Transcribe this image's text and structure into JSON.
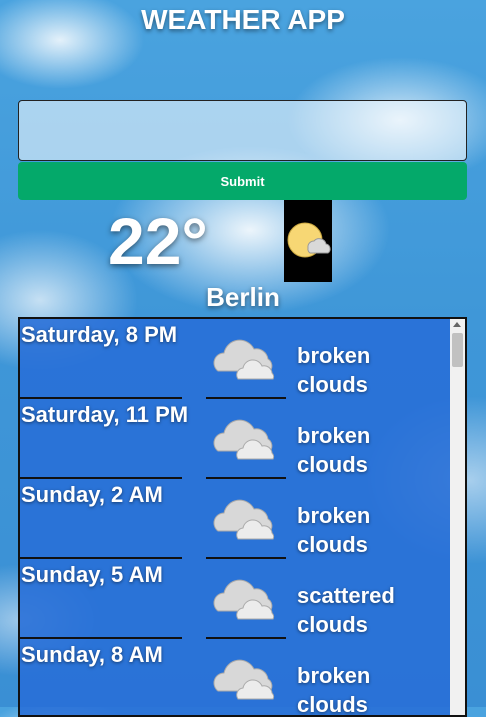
{
  "app": {
    "title": "WEATHER APP"
  },
  "search": {
    "value": "",
    "placeholder": "",
    "submit_label": "Submit"
  },
  "current": {
    "temperature": "22°",
    "city": "Berlin",
    "icon": "moon-cloud-icon"
  },
  "forecast": [
    {
      "time": "Saturday, 8 PM",
      "description": "broken clouds",
      "icon": "cloud-icon"
    },
    {
      "time": "Saturday, 11 PM",
      "description": "broken clouds",
      "icon": "cloud-icon"
    },
    {
      "time": "Sunday, 2 AM",
      "description": "broken clouds",
      "icon": "cloud-icon"
    },
    {
      "time": "Sunday, 5 AM",
      "description": "scattered clouds",
      "icon": "cloud-icon"
    },
    {
      "time": "Sunday, 8 AM",
      "description": "broken clouds",
      "icon": "cloud-icon"
    }
  ],
  "colors": {
    "submit_bg": "#04a96a",
    "forecast_bg": "#286ed7",
    "text": "#ffffff"
  }
}
